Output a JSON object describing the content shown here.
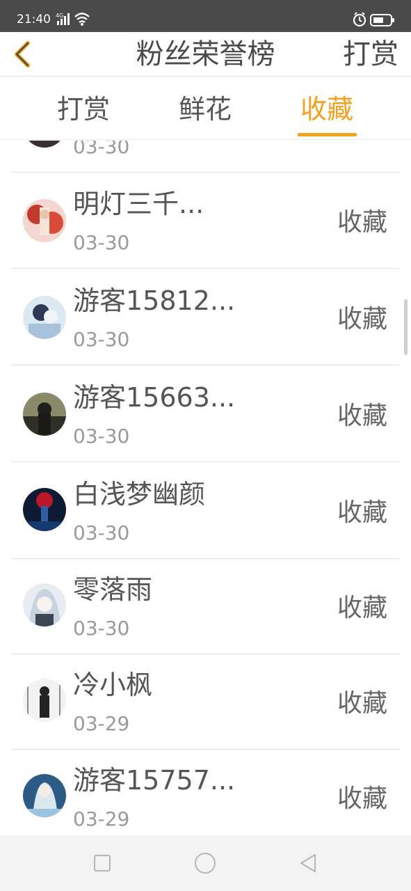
{
  "status_bar": {
    "time": "21:40",
    "network": "4G",
    "icons": [
      "signal-icon",
      "wifi-icon",
      "alarm-icon",
      "battery-icon"
    ]
  },
  "header": {
    "title": "粉丝荣誉榜",
    "right_action": "打赏",
    "back_icon": "chevron-left-icon"
  },
  "tabs": [
    {
      "label": "打赏",
      "active": false
    },
    {
      "label": "鲜花",
      "active": false
    },
    {
      "label": "收藏",
      "active": true
    }
  ],
  "accent_color": "#f5a11d",
  "list": {
    "items": [
      {
        "name": "",
        "date": "03-30",
        "action": ""
      },
      {
        "name": "明灯三千...",
        "date": "03-30",
        "action": "收藏"
      },
      {
        "name": "游客15812...",
        "date": "03-30",
        "action": "收藏"
      },
      {
        "name": "游客15663...",
        "date": "03-30",
        "action": "收藏"
      },
      {
        "name": "白浅梦幽颜",
        "date": "03-30",
        "action": "收藏"
      },
      {
        "name": "零落雨",
        "date": "03-30",
        "action": "收藏"
      },
      {
        "name": "冷小枫",
        "date": "03-29",
        "action": "收藏"
      },
      {
        "name": "游客15757...",
        "date": "03-29",
        "action": "收藏"
      }
    ]
  },
  "bottom_nav": {
    "icons": [
      "square-icon",
      "circle-icon",
      "triangle-back-icon"
    ]
  }
}
